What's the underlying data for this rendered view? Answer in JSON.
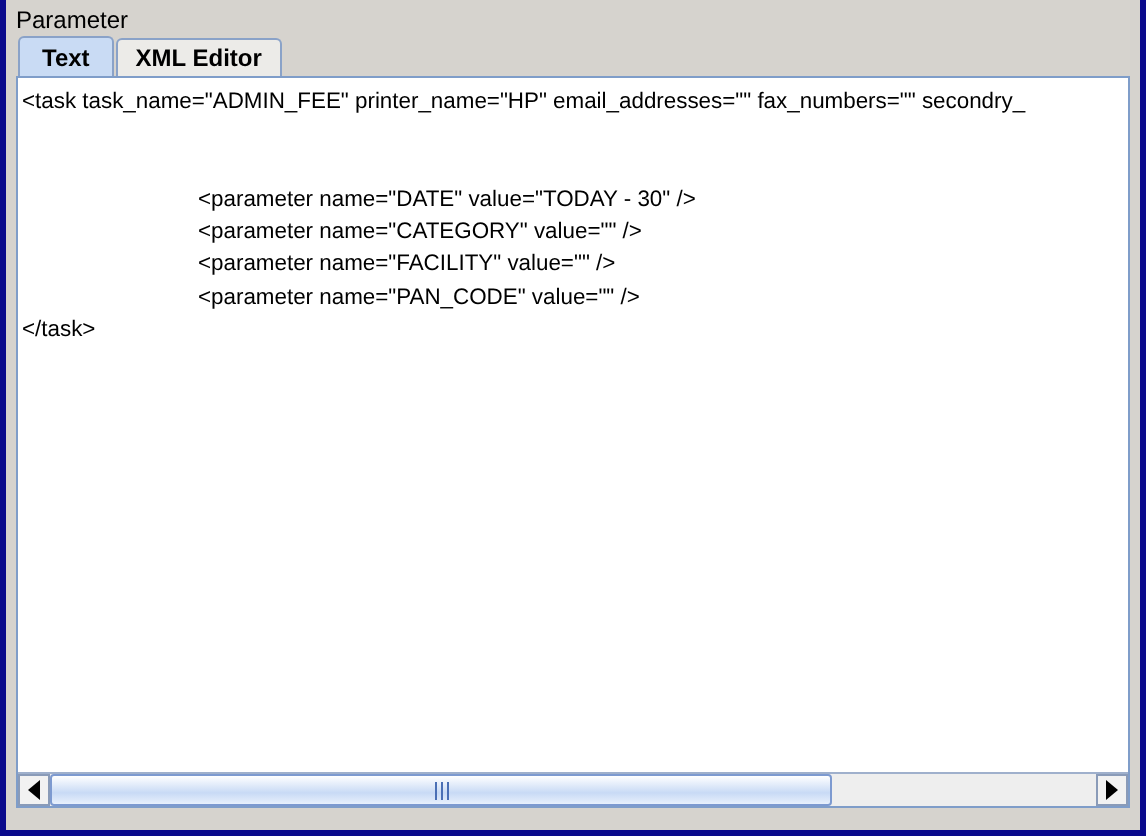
{
  "panel": {
    "title": "Parameter"
  },
  "tabs": [
    {
      "label": "Text",
      "selected": true
    },
    {
      "label": "XML Editor",
      "selected": false
    }
  ],
  "editor": {
    "lines": [
      {
        "kind": "plain",
        "text": "<task task_name=\"ADMIN_FEE\" printer_name=\"HP\" email_addresses=\"\" fax_numbers=\"\" secondry_"
      },
      {
        "kind": "blank"
      },
      {
        "kind": "blank"
      },
      {
        "kind": "indented",
        "text": "<parameter name=\"DATE\" value=\"TODAY - 30\" />"
      },
      {
        "kind": "indented",
        "text": "<parameter name=\"CATEGORY\" value=\"\" />"
      },
      {
        "kind": "indented",
        "text": "<parameter name=\"FACILITY\" value=\"\" />"
      },
      {
        "kind": "indented",
        "text": "<parameter name=\"PAN_CODE\" value=\"\" />"
      },
      {
        "kind": "plain",
        "text": "</task>"
      }
    ]
  }
}
